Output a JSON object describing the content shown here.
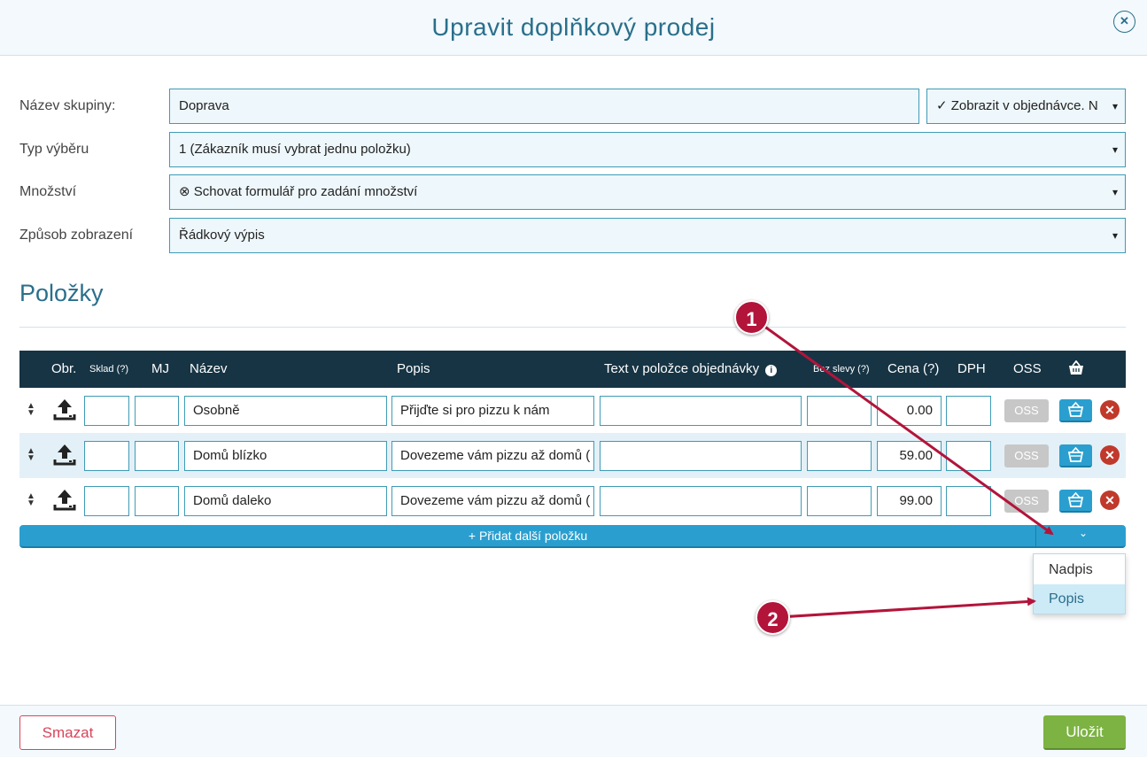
{
  "dialog": {
    "title": "Upravit doplňkový prodej",
    "close_icon": "close-icon"
  },
  "form": {
    "group_name": {
      "label": "Název skupiny:",
      "value": "Doprava",
      "display_option": "✓ Zobrazit v objednávce. N"
    },
    "selection_type": {
      "label": "Typ výběru",
      "value": "1 (Zákazník musí vybrat jednu položku)"
    },
    "quantity": {
      "label": "Množství",
      "value": "⊗ Schovat formulář pro zadání množství"
    },
    "display_mode": {
      "label": "Způsob zobrazení",
      "value": "Řádkový výpis"
    }
  },
  "items_section": {
    "title": "Položky",
    "columns": {
      "image": "Obr.",
      "stock": "Sklad (?)",
      "unit": "MJ",
      "name": "Název",
      "description": "Popis",
      "order_text": "Text v položce objednávky",
      "no_discount": "Bez slevy (?)",
      "price": "Cena (?)",
      "vat": "DPH",
      "oss": "OSS",
      "basket_icon": "basket-icon"
    },
    "rows": [
      {
        "stock": "",
        "unit": "",
        "name": "Osobně",
        "description": "Přijďte si pro pizzu k nám",
        "order_text": "",
        "no_discount": "",
        "price": "0.00",
        "vat": "",
        "oss": "OSS"
      },
      {
        "stock": "",
        "unit": "",
        "name": "Domů blízko",
        "description": "Dovezeme vám pizzu až domů (",
        "order_text": "",
        "no_discount": "",
        "price": "59.00",
        "vat": "",
        "oss": "OSS"
      },
      {
        "stock": "",
        "unit": "",
        "name": "Domů daleko",
        "description": "Dovezeme vám pizzu až domů (",
        "order_text": "",
        "no_discount": "",
        "price": "99.00",
        "vat": "",
        "oss": "OSS"
      }
    ],
    "add_button": "+ Přidat další položku",
    "dropdown_items": [
      "Nadpis",
      "Popis"
    ]
  },
  "callouts": [
    "1",
    "2"
  ],
  "footer": {
    "delete": "Smazat",
    "save": "Uložit"
  },
  "colors": {
    "accent": "#2a6f8c",
    "header_dark": "#163444",
    "button_blue": "#2a9fcf",
    "save_green": "#7cb342",
    "delete_red": "#d9445a",
    "callout": "#b3143a"
  }
}
